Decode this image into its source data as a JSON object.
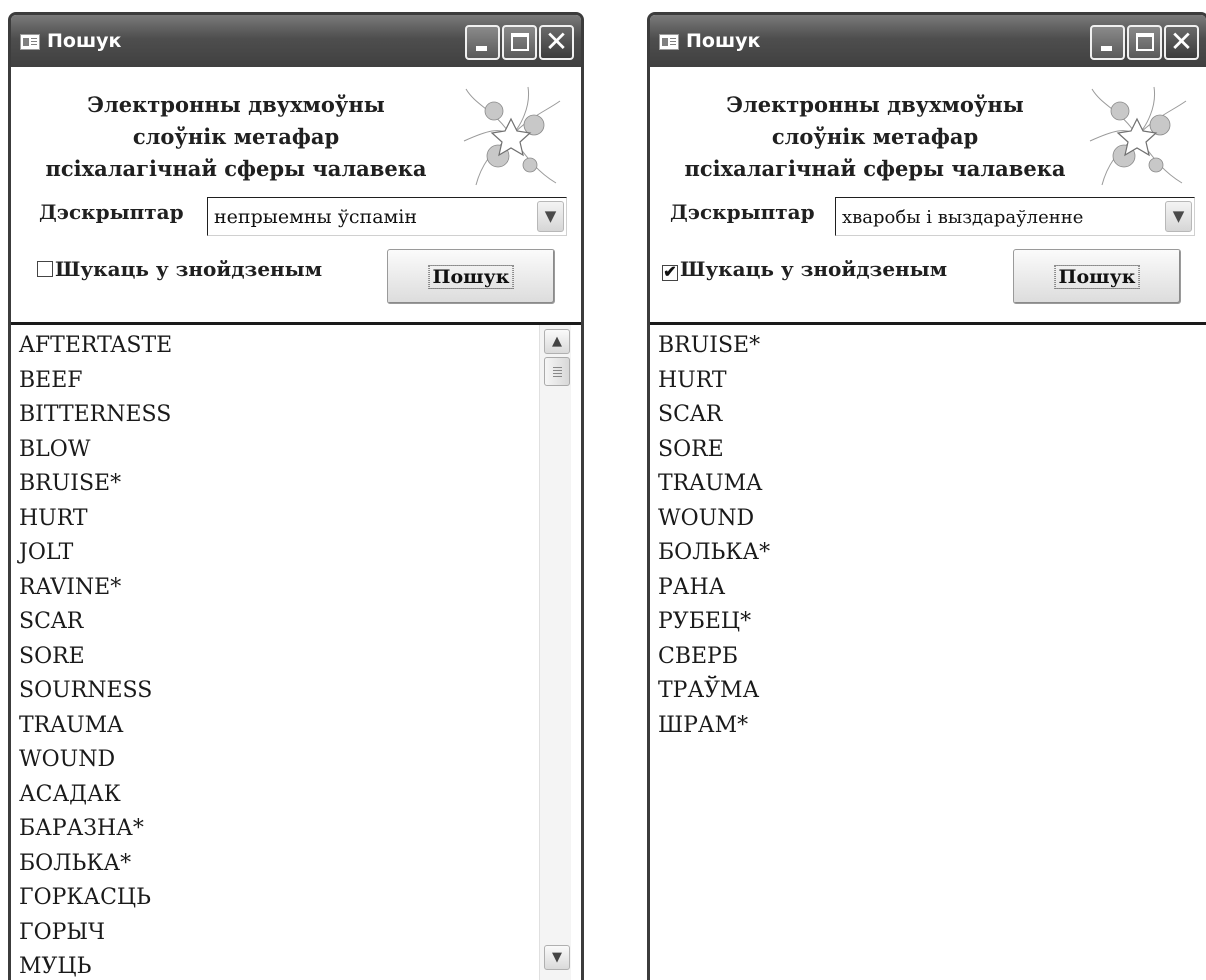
{
  "left_window": {
    "title": "Пошук",
    "heading": [
      "Электронны двухмоўны",
      "слоўнік метафар",
      "псіхалагічнай сферы чалавека"
    ],
    "descriptor_label": "Дэскрыптар",
    "descriptor_value": "непрыемны ўспамін",
    "checkbox_label": "Шукаць у знойдзеным",
    "checkbox_checked": false,
    "search_button": "Пошук",
    "results": [
      "AFTERTASTE",
      "BEEF",
      "BITTERNESS",
      "BLOW",
      "BRUISE*",
      "HURT",
      "JOLT",
      "RAVINE*",
      "SCAR",
      "SORE",
      "SOURNESS",
      "TRAUMA",
      "WOUND",
      "АСАДАК",
      "БАРАЗНА*",
      "БОЛЬКА*",
      "ГОРКАСЦЬ",
      "ГОРЫЧ",
      "МУЦЬ"
    ]
  },
  "right_window": {
    "title": "Пошук",
    "heading": [
      "Электронны двухмоўны",
      "слоўнік метафар",
      "псіхалагічнай сферы чалавека"
    ],
    "descriptor_label": "Дэскрыптар",
    "descriptor_value": "хваробы і выздараўленне",
    "checkbox_label": "Шукаць у знойдзеным",
    "checkbox_checked": true,
    "search_button": "Пошук",
    "results": [
      "BRUISE*",
      "HURT",
      "SCAR",
      "SORE",
      "TRAUMA",
      "WOUND",
      "БОЛЬКА*",
      "РАНА",
      "РУБЕЦ*",
      "СВЕРБ",
      "ТРАЎМА",
      "ШРАМ*"
    ]
  },
  "icons": {
    "window_icon": "form-icon",
    "minimize": "minimize-icon",
    "maximize": "maximize-icon",
    "close": "close-icon",
    "dropdown": "chevron-down-icon",
    "ornament": "floral-ornament-icon",
    "scroll_up": "scroll-up-icon",
    "scroll_down": "scroll-down-icon"
  },
  "colors": {
    "titlebar": "#4e4e4e",
    "window_border": "#3c3c3c",
    "text": "#1a1a1a"
  }
}
